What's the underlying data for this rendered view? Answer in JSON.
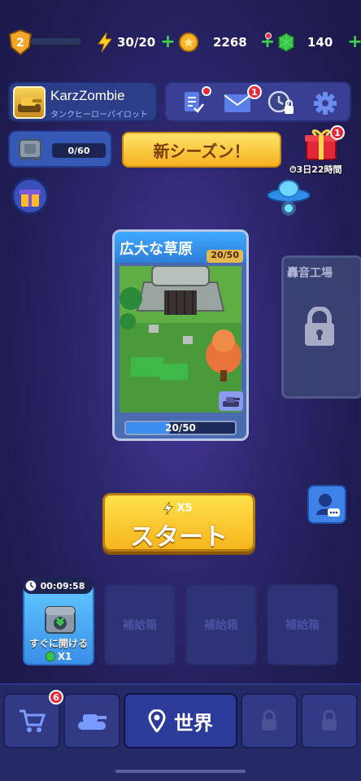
{
  "top_bar": {
    "level": "2",
    "xp_fraction": 0.0,
    "energy": "30/20",
    "coins": "2268",
    "gems": "140"
  },
  "player": {
    "name": "KarzZombie",
    "title": "タンクヒーローパイロット"
  },
  "icon_bar": {
    "mail_badge": "1"
  },
  "vault": {
    "progress": "0/60"
  },
  "season_banner": "新シーズン！",
  "gift": {
    "badge": "1",
    "timer": "3日22時間"
  },
  "stage": {
    "name": "広大な草原",
    "count": "20/50",
    "progress_text": "20/50",
    "progress_fraction": 0.4
  },
  "stage_next": {
    "name": "轟音工場"
  },
  "start_button": {
    "label": "スタート",
    "cost": "X5"
  },
  "chests": {
    "timer": "00:09:58",
    "open_now": "すぐに開ける",
    "gem_cost": "X1",
    "slots": [
      "補給箱",
      "補給箱",
      "補給箱"
    ]
  },
  "nav": {
    "shop_badge": "6",
    "world_label": "世界"
  },
  "colors": {
    "accent_yellow": "#f6b51d",
    "badge_red": "#e52a3a",
    "plus_green": "#3fd24a",
    "bg_purple": "#2e2870"
  }
}
